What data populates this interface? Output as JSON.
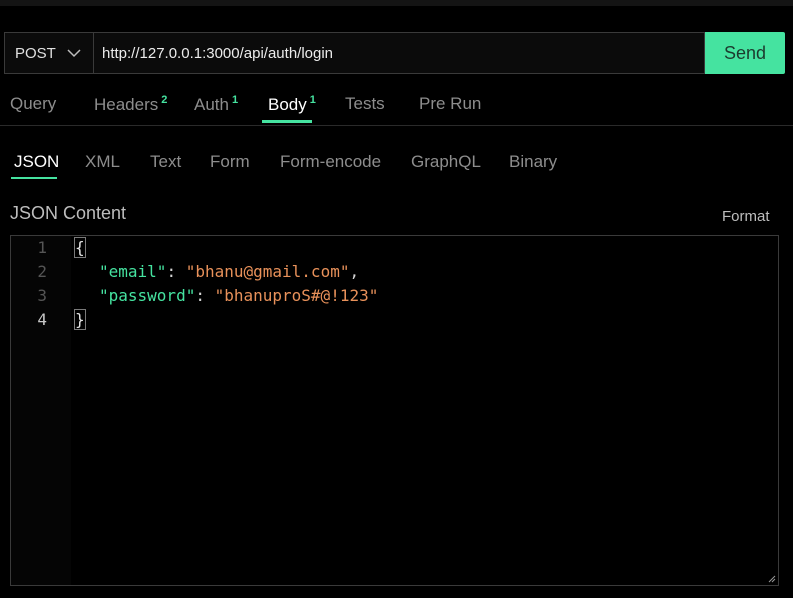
{
  "request": {
    "method": "POST",
    "url": "http://127.0.0.1:3000/api/auth/login",
    "send_label": "Send"
  },
  "tabs": [
    {
      "label": "Query",
      "badge": ""
    },
    {
      "label": "Headers",
      "badge": "2"
    },
    {
      "label": "Auth",
      "badge": "1"
    },
    {
      "label": "Body",
      "badge": "1",
      "active": true
    },
    {
      "label": "Tests",
      "badge": ""
    },
    {
      "label": "Pre Run",
      "badge": ""
    }
  ],
  "body_tabs": [
    {
      "label": "JSON",
      "active": true
    },
    {
      "label": "XML"
    },
    {
      "label": "Text"
    },
    {
      "label": "Form"
    },
    {
      "label": "Form-encode"
    },
    {
      "label": "GraphQL"
    },
    {
      "label": "Binary"
    }
  ],
  "content_label": "JSON Content",
  "format_label": "Format",
  "editor": {
    "line_numbers": [
      "1",
      "2",
      "3",
      "4"
    ],
    "open_brace": "{",
    "close_brace": "}",
    "lines": [
      {
        "key": "\"email\"",
        "sep": ": ",
        "value": "\"bhanu@gmail.com\"",
        "trail": ","
      },
      {
        "key": "\"password\"",
        "sep": ": ",
        "value": "\"bhanuproS#@!123\"",
        "trail": ""
      }
    ]
  },
  "colors": {
    "accent": "#45e3a0",
    "string": "#e8915a",
    "background": "#000000"
  }
}
